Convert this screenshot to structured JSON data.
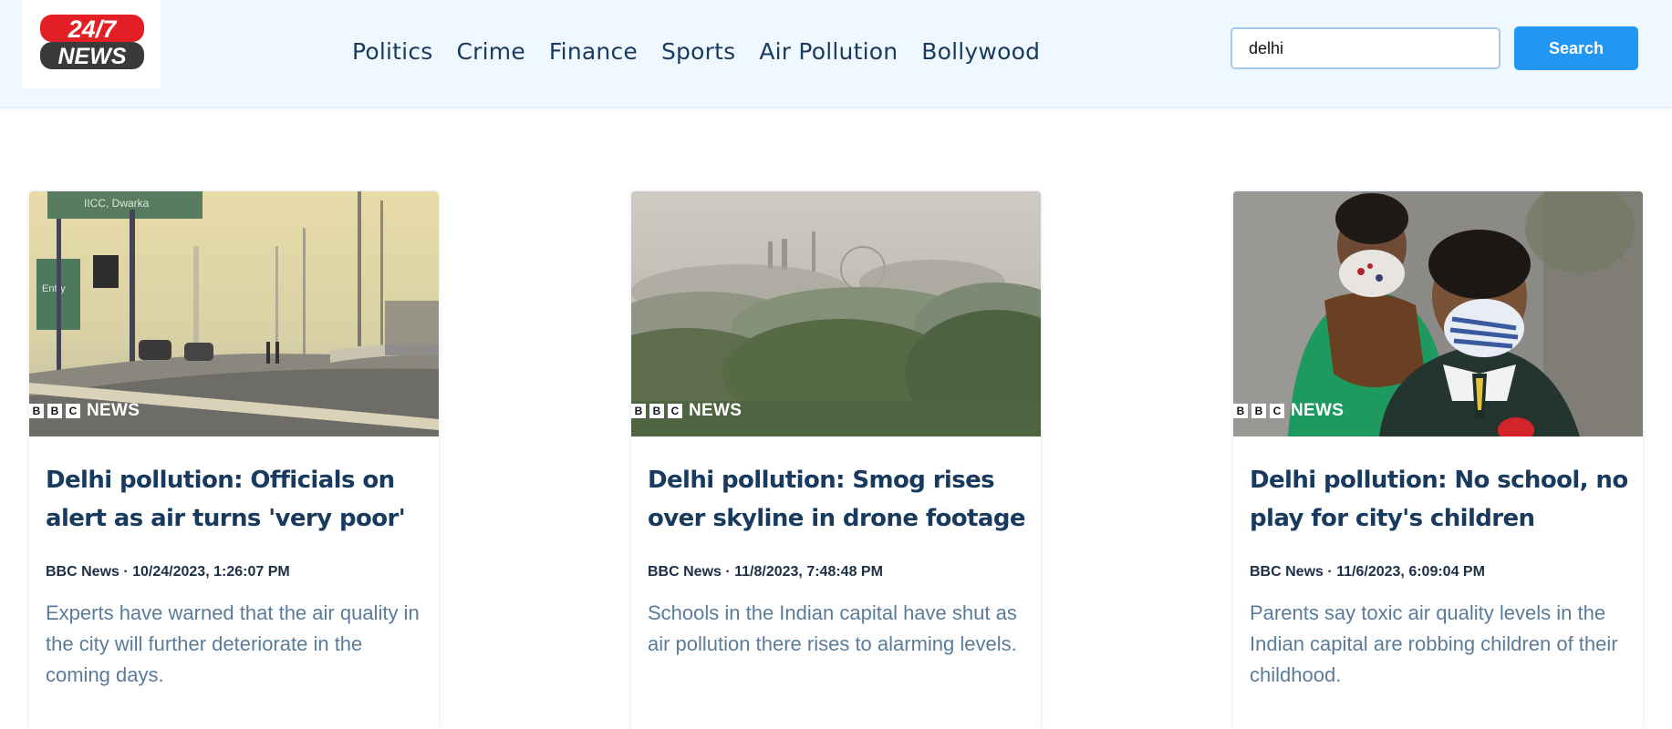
{
  "header": {
    "logo": {
      "line1": "24/7",
      "line2": "NEWS"
    },
    "nav": [
      "Politics",
      "Crime",
      "Finance",
      "Sports",
      "Air Pollution",
      "Bollywood"
    ],
    "search": {
      "value": "delhi",
      "button_label": "Search"
    }
  },
  "articles": [
    {
      "title": "Delhi pollution: Officials on alert as air turns 'very poor'",
      "meta": "BBC News · 10/24/2023, 1:26:07 PM",
      "description": "Experts have warned that the air quality in the city will further deteriorate in the coming days.",
      "watermark": {
        "b1": "B",
        "b2": "B",
        "c": "C",
        "news": "NEWS"
      },
      "sign_text": "IICC, Dwarka",
      "sign_text_2": "Entry"
    },
    {
      "title": "Delhi pollution: Smog rises over skyline in drone footage",
      "meta": "BBC News · 11/8/2023, 7:48:48 PM",
      "description": "Schools in the Indian capital have shut as air pollution there rises to alarming levels.",
      "watermark": {
        "b1": "B",
        "b2": "B",
        "c": "C",
        "news": "NEWS"
      }
    },
    {
      "title": "Delhi pollution: No school, no play for city's children",
      "meta": "BBC News · 11/6/2023, 6:09:04 PM",
      "description": "Parents say toxic air quality levels in the Indian capital are robbing children of their childhood.",
      "watermark": {
        "b1": "B",
        "b2": "B",
        "c": "C",
        "news": "NEWS"
      }
    }
  ],
  "colors": {
    "header_bg": "#f0f8ff",
    "nav_text": "#173a5e",
    "button_bg": "#2196f3",
    "title_text": "#173a5e",
    "desc_text": "#5b7b9a",
    "logo_red": "#e31e24"
  }
}
